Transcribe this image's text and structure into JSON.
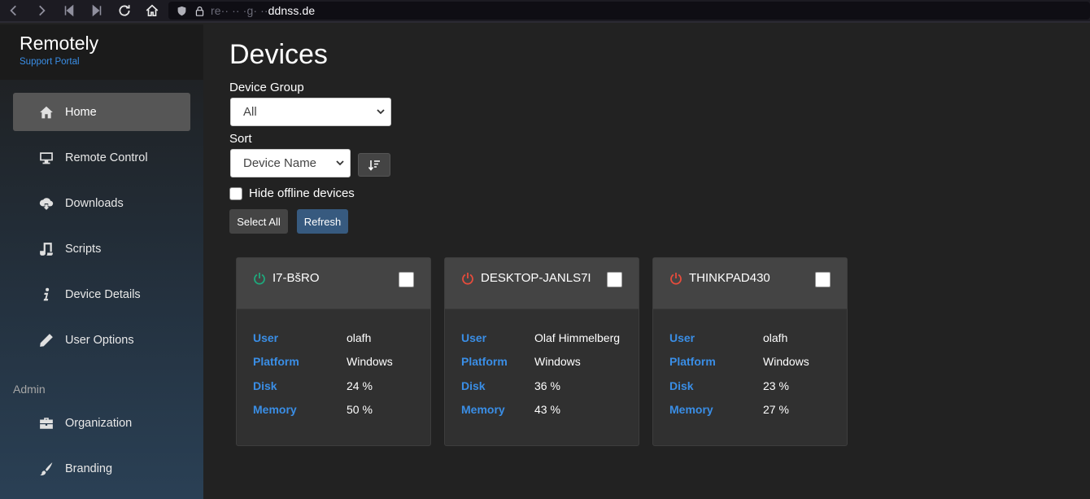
{
  "browser": {
    "url_prefix": "re·· ·· ·g·  ··",
    "url_domain": "ddnss.de"
  },
  "sidebar": {
    "brand_title": "Remotely",
    "brand_subtitle": "Support Portal",
    "items": [
      {
        "label": "Home",
        "icon": "home-icon",
        "active": true
      },
      {
        "label": "Remote Control",
        "icon": "monitor-icon"
      },
      {
        "label": "Downloads",
        "icon": "cloud-download-icon"
      },
      {
        "label": "Scripts",
        "icon": "script-icon"
      },
      {
        "label": "Device Details",
        "icon": "info-icon"
      },
      {
        "label": "User Options",
        "icon": "pencil-icon"
      }
    ],
    "admin_label": "Admin",
    "admin_items": [
      {
        "label": "Organization",
        "icon": "briefcase-icon"
      },
      {
        "label": "Branding",
        "icon": "brush-icon"
      }
    ]
  },
  "main": {
    "title": "Devices",
    "device_group_label": "Device Group",
    "device_group_value": "All",
    "sort_label": "Sort",
    "sort_value": "Device Name",
    "hide_offline_label": "Hide offline devices",
    "select_all_label": "Select All",
    "refresh_label": "Refresh"
  },
  "field_labels": {
    "user": "User",
    "platform": "Platform",
    "disk": "Disk",
    "memory": "Memory"
  },
  "devices": [
    {
      "name": "I7-BšRO",
      "online": true,
      "user": "olafh",
      "platform": "Windows",
      "disk": "24 %",
      "memory": "50 %"
    },
    {
      "name": "DESKTOP-JANLS7I",
      "online": false,
      "user": "Olaf Himmelberg",
      "platform": "Windows",
      "disk": "36 %",
      "memory": "43 %"
    },
    {
      "name": "THINKPAD430",
      "online": false,
      "user": "olafh",
      "platform": "Windows",
      "disk": "23 %",
      "memory": "27 %"
    }
  ],
  "colors": {
    "online": "#1ea97c",
    "offline": "#e74c3c",
    "accent": "#3a8ee6",
    "refresh_button": "#375a7f"
  }
}
